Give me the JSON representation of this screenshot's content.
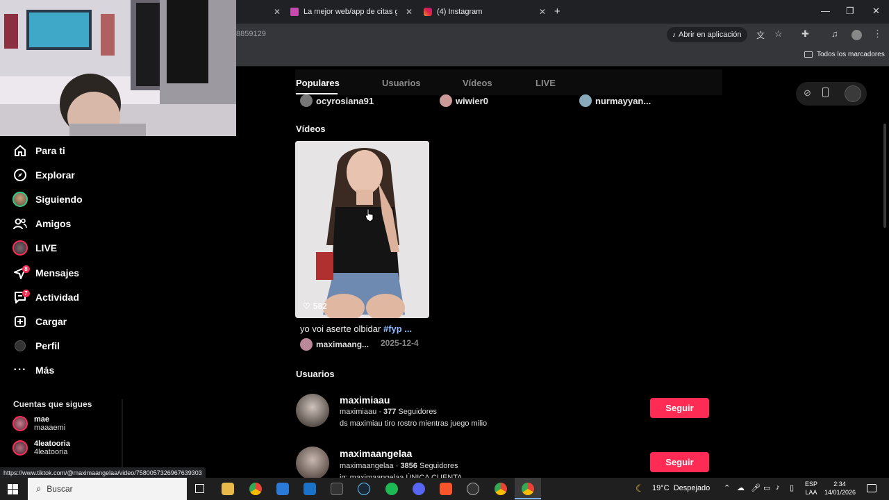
{
  "tabs": [
    {
      "title": "La mejor web/app de citas grat"
    },
    {
      "title": "(4) Instagram"
    }
  ],
  "toolbar": {
    "url_fragment": "8859129",
    "open_in_app": "Abrir en aplicación"
  },
  "bookmarks": {
    "all_bookmarks": "Todos los marcadores"
  },
  "sidebar": {
    "items": [
      {
        "label": "Para ti",
        "icon": "home-icon"
      },
      {
        "label": "Explorar",
        "icon": "compass-icon"
      },
      {
        "label": "Siguiendo",
        "icon": "avatar"
      },
      {
        "label": "Amigos",
        "icon": "friends-icon"
      },
      {
        "label": "LIVE",
        "icon": "live-avatar"
      },
      {
        "label": "Mensajes",
        "icon": "messages-icon",
        "badge": "8"
      },
      {
        "label": "Actividad",
        "icon": "activity-icon",
        "badge": "7"
      },
      {
        "label": "Cargar",
        "icon": "upload-icon"
      },
      {
        "label": "Perfil",
        "icon": "profile-avatar"
      },
      {
        "label": "Más",
        "icon": "more-icon"
      }
    ],
    "following_title": "Cuentas que sigues",
    "following": [
      {
        "name": "mae",
        "handle": "maaaemi"
      },
      {
        "name": "4leatooria",
        "handle": "4leatooria"
      }
    ]
  },
  "search_tabs": [
    "Populares",
    "Usuarios",
    "Vídeos",
    "LIVE"
  ],
  "top_users": [
    "ocyrosiana91",
    "wiwier0",
    "nurmayyan..."
  ],
  "videos_section": {
    "title": "Vídeos",
    "video": {
      "likes": "582",
      "caption": "yo voi aserte olbidar",
      "hashtag": "#fyp ...",
      "author": "maximaang...",
      "date": "2025-12-4"
    }
  },
  "users_section": {
    "title": "Usuarios",
    "users": [
      {
        "name": "maximiaau",
        "handle": "maximiaau",
        "followers": "377",
        "followers_label": "Seguidores",
        "bio": "ds maximiau tiro rostro mientras juego milio",
        "follow": "Seguir"
      },
      {
        "name": "maximaangelaa",
        "handle": "maximaangelaa",
        "followers": "3856",
        "followers_label": "Seguidores",
        "bio": "ig: maximaangelaa ÚNICA CUENTA",
        "follow": "Seguir"
      }
    ]
  },
  "status_url": "https://www.tiktok.com/@maximaangelaa/video/7580057326967639303",
  "taskbar": {
    "search_placeholder": "Buscar",
    "weather": "19°C  Despejado",
    "lang1": "ESP",
    "lang2": "LAA",
    "time": "2:34",
    "date": "14/01/2026"
  },
  "colors": {
    "accent": "#fe2c55",
    "hashtag": "#8fbcff",
    "chrome_dark": "#202124",
    "chrome_mid": "#35363a"
  }
}
